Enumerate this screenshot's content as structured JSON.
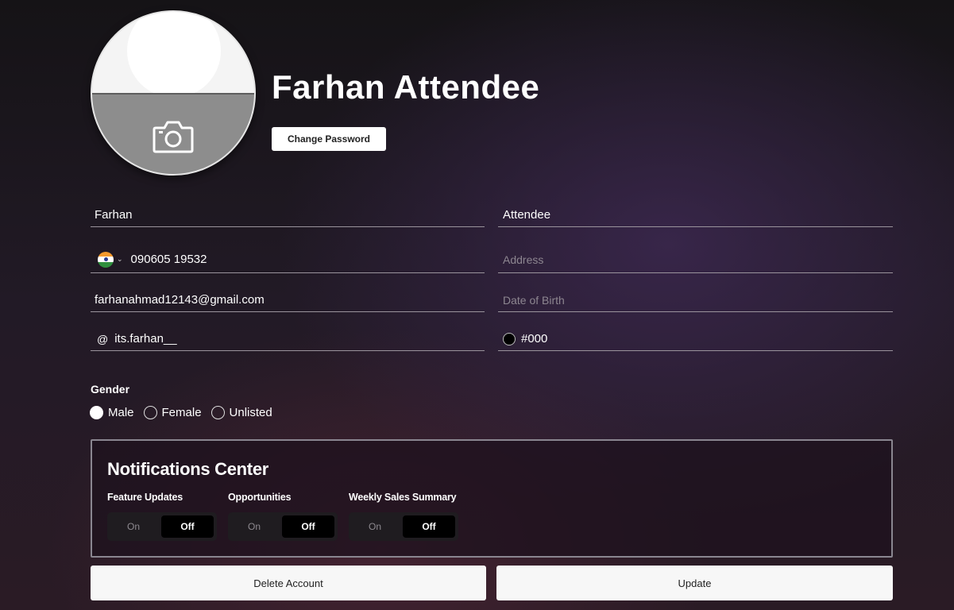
{
  "profile": {
    "name": "Farhan Attendee",
    "change_password_label": "Change Password"
  },
  "form": {
    "first_name": "Farhan",
    "last_name": "Attendee",
    "phone": "090605 19532",
    "phone_country": "india-flag-icon",
    "address_placeholder": "Address",
    "email": "farhanahmad12143@gmail.com",
    "dob_placeholder": "Date of Birth",
    "handle_prefix": "@",
    "handle": "its.farhan__",
    "color_value": "#000"
  },
  "gender": {
    "label": "Gender",
    "options": [
      "Male",
      "Female",
      "Unlisted"
    ],
    "selected": "Male"
  },
  "notifications": {
    "title": "Notifications Center",
    "groups": [
      {
        "label": "Feature Updates",
        "on": "On",
        "off": "Off",
        "state": "Off"
      },
      {
        "label": "Opportunities",
        "on": "On",
        "off": "Off",
        "state": "Off"
      },
      {
        "label": "Weekly Sales Summary",
        "on": "On",
        "off": "Off",
        "state": "Off"
      }
    ]
  },
  "actions": {
    "delete_label": "Delete Account",
    "update_label": "Update"
  },
  "colors": {
    "background": "#1a1420",
    "button_bg": "#f7f7f7",
    "toggle_active": "#000000"
  }
}
